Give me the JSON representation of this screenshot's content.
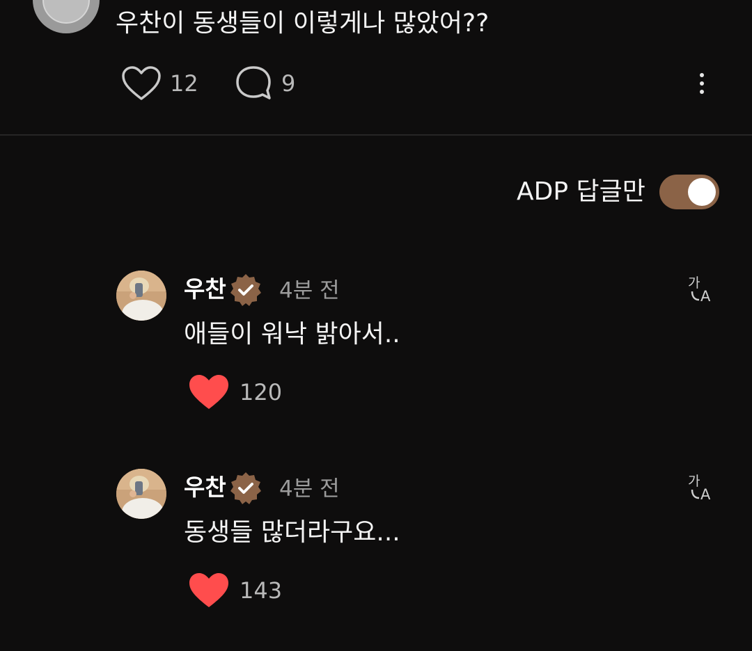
{
  "post": {
    "text": "우찬이 동생들이 이렇게나 많았어??",
    "like_count": "12",
    "comment_count": "9"
  },
  "filter": {
    "label": "ADP 답글만",
    "enabled": true
  },
  "replies": [
    {
      "author": "우찬",
      "time": "4분 전",
      "text": "애들이 워낙 밝아서..",
      "like_count": "120",
      "liked": true
    },
    {
      "author": "우찬",
      "time": "4분 전",
      "text": "동생들 많더라구요...",
      "like_count": "143",
      "liked": true
    }
  ],
  "colors": {
    "background": "#0e0d0d",
    "accent_brown": "#8b6347",
    "heart_red": "#ff4d4d"
  },
  "icons": {
    "like": "heart-outline-icon",
    "comment": "speech-bubble-icon",
    "more": "vertical-dots-icon",
    "verified": "verified-badge-icon",
    "translate": "translate-icon",
    "liked": "heart-filled-icon"
  }
}
